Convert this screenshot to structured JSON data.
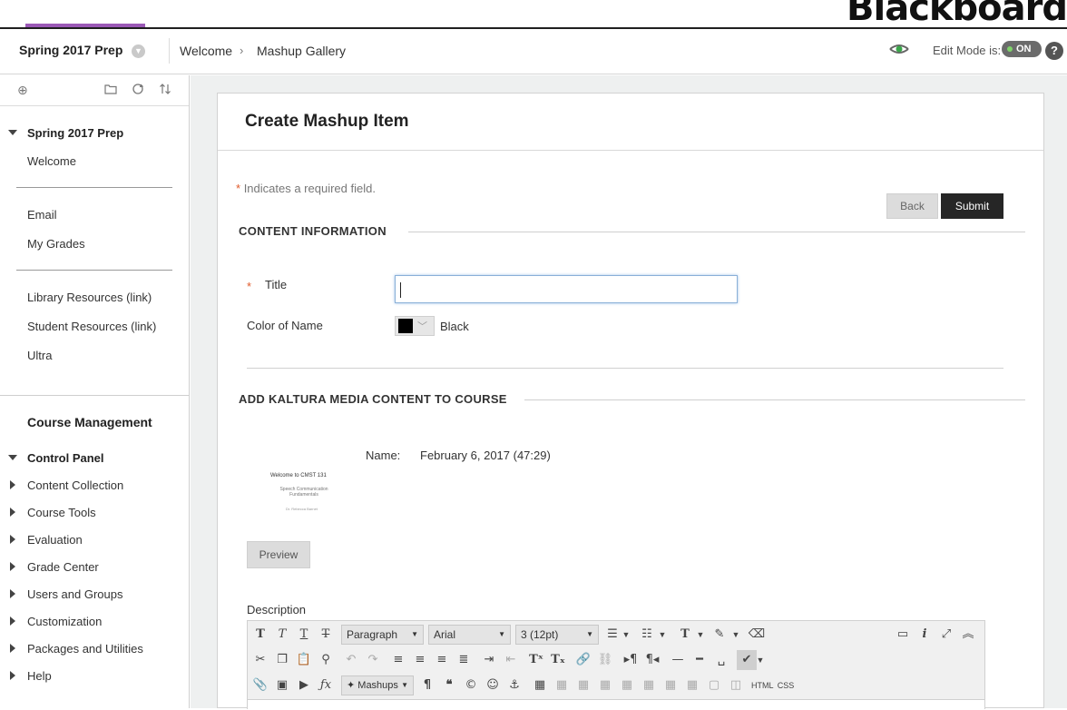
{
  "brand": {
    "logo": "Blackboard"
  },
  "breadcrumb": {
    "course": "Spring 2017 Prep",
    "items": [
      "Welcome",
      "Mashup Gallery"
    ],
    "separator": "›"
  },
  "header": {
    "edit_mode_label": "Edit Mode is:",
    "edit_mode_state": "ON",
    "help": "?"
  },
  "sidebar": {
    "course_title": "Spring 2017 Prep",
    "group1": [
      "Welcome"
    ],
    "group2": [
      "Email",
      "My Grades"
    ],
    "group3": [
      "Library Resources (link)",
      "Student Resources (link)",
      "Ultra"
    ],
    "management_title": "Course Management",
    "control_panel": "Control Panel",
    "cp_items": [
      "Content Collection",
      "Course Tools",
      "Evaluation",
      "Grade Center",
      "Users and Groups",
      "Customization",
      "Packages and Utilities",
      "Help"
    ]
  },
  "page": {
    "title": "Create Mashup Item",
    "required_star": "*",
    "required_note": "Indicates a required field.",
    "back_label": "Back",
    "submit_label": "Submit"
  },
  "content_info": {
    "heading": "CONTENT INFORMATION",
    "title_label": "Title",
    "title_value": "",
    "color_label": "Color of Name",
    "color_value": "Black",
    "color_hex": "#000000"
  },
  "kaltura": {
    "heading": "ADD KALTURA MEDIA CONTENT TO COURSE",
    "name_label": "Name:",
    "name_value": "February 6, 2017 (47:29)",
    "thumb_title": "Welcome to CMST 131",
    "thumb_subtitle": "Speech Communication Fundamentals",
    "thumb_author": "Dr. Rebecca Barnet",
    "preview_label": "Preview"
  },
  "description": {
    "label": "Description",
    "paragraph_select": "Paragraph",
    "font_select": "Arial",
    "size_select": "3 (12pt)",
    "mashups_label": "Mashups",
    "html_label": "HTML",
    "css_label": "CSS"
  }
}
